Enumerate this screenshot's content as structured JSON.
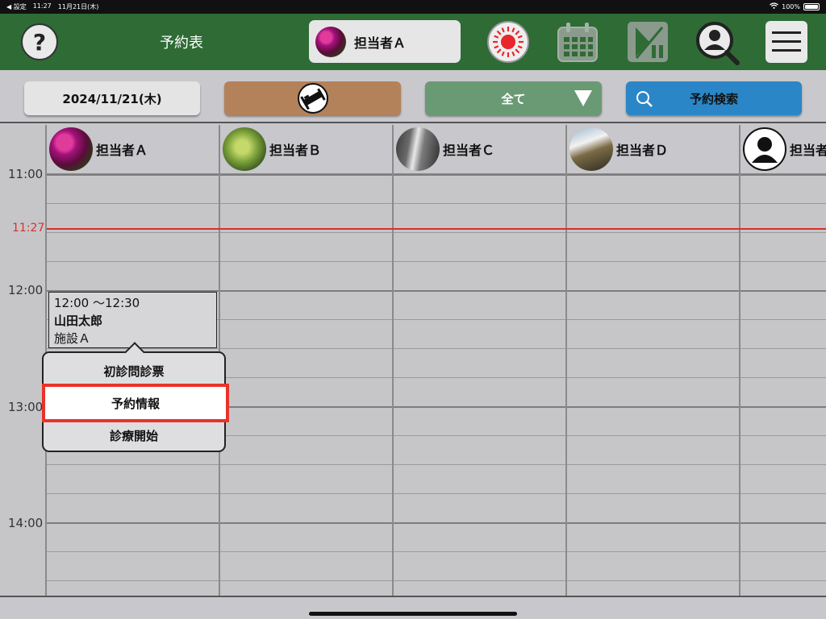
{
  "status_bar": {
    "back_label": "◀ 設定",
    "time": "11:27",
    "date": "11月21日(木)",
    "battery": "100%"
  },
  "header": {
    "help_label": "?",
    "title": "予約表",
    "staff_selector": "担当者Ａ"
  },
  "toolbar": {
    "date": "2024/11/21(木)",
    "filter": "全て",
    "search": "予約検索"
  },
  "staff_columns": [
    "担当者Ａ",
    "担当者Ｂ",
    "担当者Ｃ",
    "担当者Ｄ",
    "担当者"
  ],
  "time_labels": [
    "11:00",
    "12:00",
    "13:00",
    "14:00"
  ],
  "current_time": "11:27",
  "appointment": {
    "time": "12:00 ～12:30",
    "patient": "山田太郎",
    "facility": "施設Ａ"
  },
  "context_menu": {
    "items": [
      "初診問診票",
      "予約情報",
      "診療開始"
    ],
    "selected": "予約情報"
  },
  "colors": {
    "header_green": "#2e6b35",
    "now_line": "#d9302a",
    "highlight": "#e8332a",
    "search_blue": "#2a86c7",
    "bed_brown": "#b4825a",
    "filter_green": "#6a9a74"
  }
}
